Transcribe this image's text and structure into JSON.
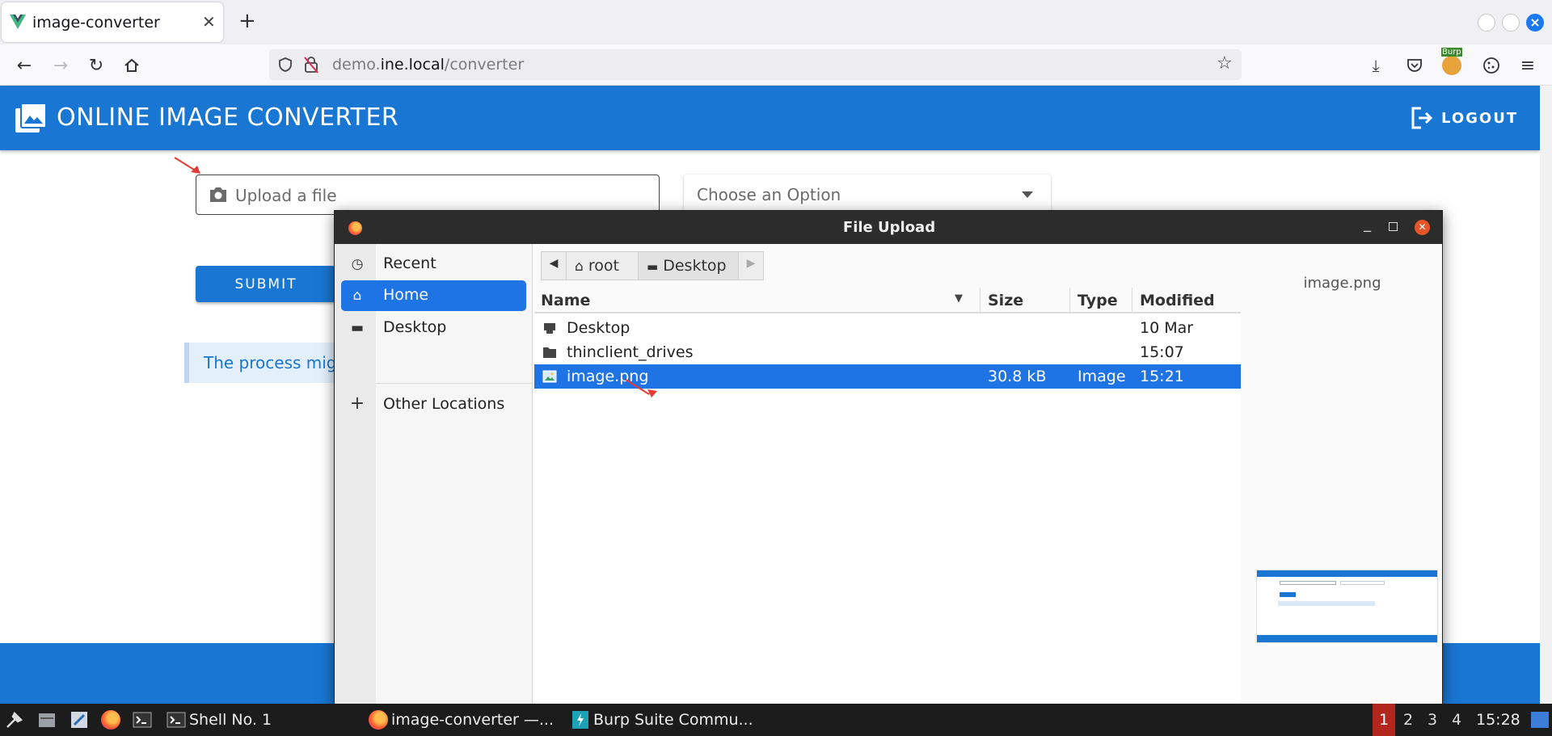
{
  "browser": {
    "tab_title": "image-converter",
    "new_tab": "+",
    "url_host_prefix": "demo.",
    "url_host_main": "ine.local",
    "url_path": "/converter",
    "burp_badge": "Burp"
  },
  "app": {
    "title": "ONLINE IMAGE CONVERTER",
    "logout": "LOGOUT",
    "upload_placeholder": "Upload a file",
    "select_placeholder": "Choose an Option",
    "submit": "SUBMIT",
    "info_text": "The process mig"
  },
  "dialog": {
    "title": "File Upload",
    "places": [
      {
        "label": "Recent",
        "icon": "clock-icon"
      },
      {
        "label": "Home",
        "icon": "home-icon"
      },
      {
        "label": "Desktop",
        "icon": "drive-icon"
      },
      {
        "label": "Other Locations",
        "icon": "plus-icon"
      }
    ],
    "path": [
      "root",
      "Desktop"
    ],
    "columns": {
      "name": "Name",
      "size": "Size",
      "type": "Type",
      "modified": "Modified"
    },
    "files": [
      {
        "name": "Desktop",
        "size": "",
        "type": "",
        "modified": "10 Mar",
        "icon": "drive-icon"
      },
      {
        "name": "thinclient_drives",
        "size": "",
        "type": "",
        "modified": "15:07",
        "icon": "folder-icon"
      },
      {
        "name": "image.png",
        "size": "30.8  kB",
        "type": "Image",
        "modified": "15:21",
        "icon": "image-icon",
        "selected": true
      }
    ],
    "preview_label": "image.png"
  },
  "taskbar": {
    "apps": [
      "Shell No. 1",
      "image-converter —...",
      "Burp Suite Commu..."
    ],
    "workspaces": [
      "1",
      "2",
      "3",
      "4"
    ],
    "clock": "15:28"
  },
  "colors": {
    "brand": "#1976d2",
    "selection": "#1e73e5",
    "annotation": "#e53935"
  }
}
